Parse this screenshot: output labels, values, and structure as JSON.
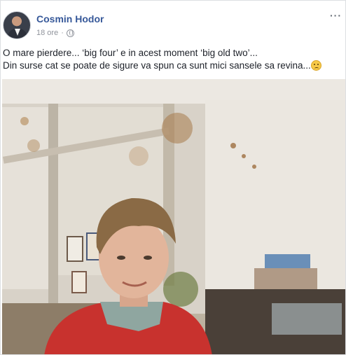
{
  "post": {
    "author": "Cosmin Hodor",
    "time": "18 ore",
    "separator": "·",
    "more_label": "···",
    "text_line1": "O mare pierdere... ‘big four’ e in acest moment ‘big old two’...",
    "text_line2": "Din surse cat se poate de sigure va spun ca sunt mici sansele sa revina...",
    "emoji": "worried-face-emoji",
    "privacy_icon": "globe-icon"
  },
  "photo": {
    "description_icon": "photo-image"
  },
  "colors": {
    "author_link": "#365899",
    "meta": "#90949c",
    "text": "#1d2129",
    "sweater": "#c8322e"
  }
}
